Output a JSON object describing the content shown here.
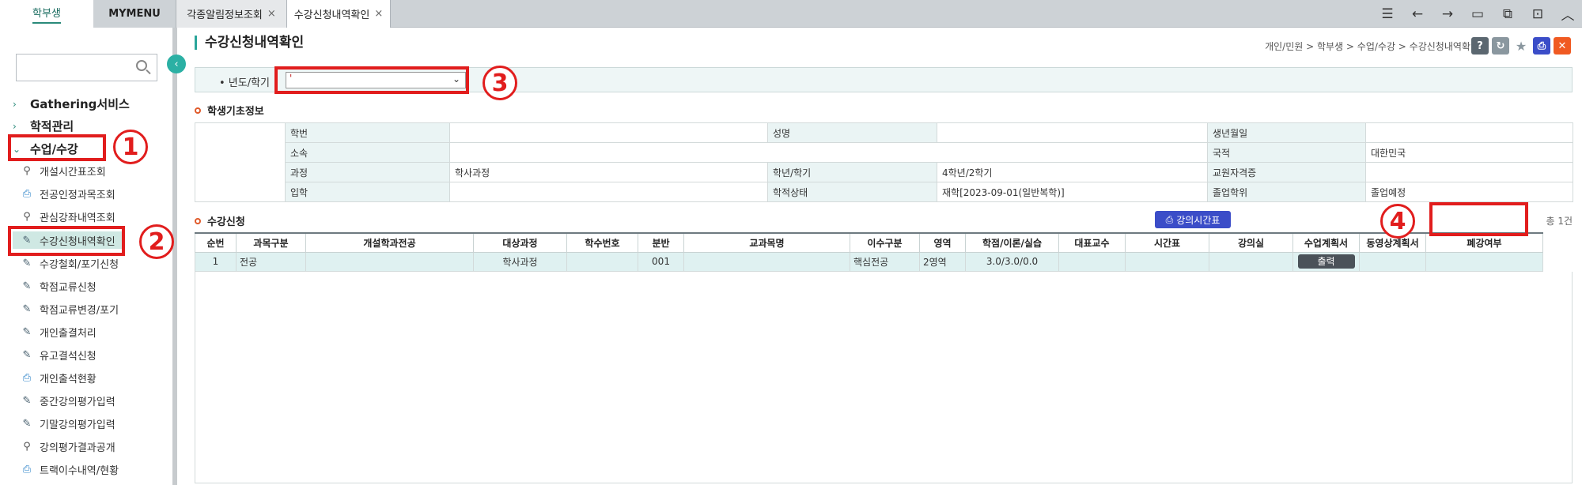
{
  "top_tabs": [
    {
      "label": "학부생"
    },
    {
      "label": "MYMENU"
    },
    {
      "label": "각종알림정보조회",
      "close": "×"
    },
    {
      "label": "수강신청내역확인",
      "close": "×"
    }
  ],
  "top_icons": [
    "menu-icon",
    "arrow-left-icon",
    "arrow-right-icon",
    "window-icon",
    "tile-icon",
    "new-window-icon",
    "chevron-up-icon"
  ],
  "sidebar": {
    "search": {
      "value": "",
      "placeholder": ""
    },
    "groups": [
      {
        "label": "Gathering서비스",
        "chevron": ">"
      },
      {
        "label": "학적관리",
        "chevron": ">"
      },
      {
        "label": "수업/수강",
        "chevron": "v"
      }
    ],
    "items": [
      {
        "label": "개설시간표조회",
        "icon": "search-icon"
      },
      {
        "label": "전공인정과목조회",
        "icon": "printer-icon"
      },
      {
        "label": "관심강좌내역조회",
        "icon": "search-icon"
      },
      {
        "label": "수강신청내역확인",
        "icon": "edit-icon"
      },
      {
        "label": "수강철회/포기신청",
        "icon": "edit-icon"
      },
      {
        "label": "학점교류신청",
        "icon": "edit-icon"
      },
      {
        "label": "학점교류변경/포기",
        "icon": "edit-icon"
      },
      {
        "label": "개인출결처리",
        "icon": "edit-icon"
      },
      {
        "label": "유고결석신청",
        "icon": "edit-icon"
      },
      {
        "label": "개인출석현황",
        "icon": "printer-icon"
      },
      {
        "label": "중간강의평가입력",
        "icon": "edit-icon"
      },
      {
        "label": "기말강의평가입력",
        "icon": "edit-icon"
      },
      {
        "label": "강의평가결과공개",
        "icon": "search-icon"
      },
      {
        "label": "트랙이수내역/현황",
        "icon": "printer-icon"
      }
    ]
  },
  "annotations": [
    "1",
    "2",
    "3",
    "4"
  ],
  "main": {
    "title": "수강신청내역확인",
    "breadcrumb": "개인/민원 > 학부생 > 수업/수강 > 수강신청내역확인",
    "actions": [
      "?",
      "↻",
      "★",
      "⎙",
      "✕"
    ],
    "filter": {
      "label": "• 년도/학기",
      "value": "'"
    },
    "student_section_title": "학생기초정보",
    "student_info": {
      "row1": [
        "학번",
        "",
        "성명",
        "",
        "생년월일",
        ""
      ],
      "row2": [
        "소속",
        "",
        "",
        "",
        "국적",
        "대한민국"
      ],
      "row3": [
        "과정",
        "학사과정",
        "학년/학기",
        "4학년/2학기",
        "교원자격증",
        ""
      ],
      "row4": [
        "입학",
        "",
        "학적상태",
        "재학[2023-09-01(일반복학)]",
        "졸업학위",
        "졸업예정"
      ]
    },
    "reg_section_title": "수강신청",
    "timetable_button": "강의시간표",
    "count": "총 1건",
    "columns": [
      "순번",
      "과목구분",
      "개설학과전공",
      "대상과정",
      "학수번호",
      "분반",
      "교과목명",
      "이수구분",
      "영역",
      "학점/이론/실습",
      "대표교수",
      "시간표",
      "강의실",
      "수업계획서",
      "동영상계획서",
      "폐강여부"
    ],
    "rows": [
      [
        "1",
        "전공",
        "",
        "학사과정",
        "",
        "001",
        "",
        "핵심전공",
        "2영역",
        "3.0/3.0/0.0",
        "",
        "",
        "",
        "출력",
        "",
        ""
      ]
    ]
  }
}
